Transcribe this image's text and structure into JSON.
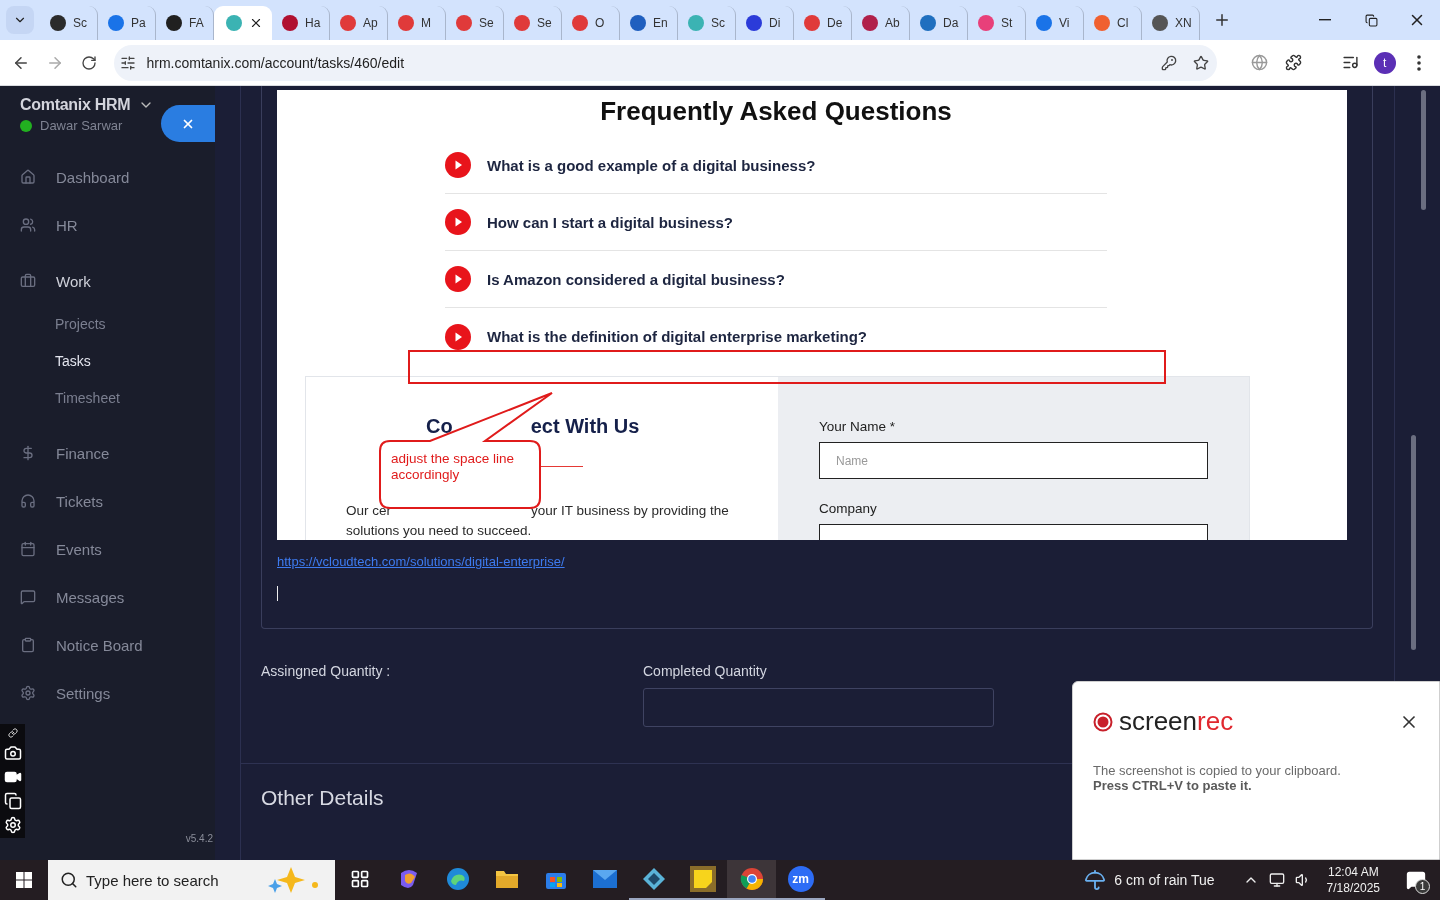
{
  "browser": {
    "tabs": [
      {
        "label": "Sc",
        "selected": false,
        "color": "#2b2b2b"
      },
      {
        "label": "Pa",
        "selected": false,
        "color": "#1a73e8"
      },
      {
        "label": "FA",
        "selected": false,
        "color": "#202020"
      },
      {
        "selected": true,
        "color": "#3bb3b3"
      },
      {
        "label": "Ha",
        "selected": false,
        "color": "#b01030"
      },
      {
        "label": "Ap",
        "selected": false,
        "color": "#e03a3a"
      },
      {
        "label": "M",
        "selected": false,
        "color": "#e03a3a"
      },
      {
        "label": "Se",
        "selected": false,
        "color": "#e03a3a"
      },
      {
        "label": "Se",
        "selected": false,
        "color": "#e03a3a"
      },
      {
        "label": "O",
        "selected": false,
        "color": "#e03a3a"
      },
      {
        "label": "En",
        "selected": false,
        "color": "#1f5fbf"
      },
      {
        "label": "Sc",
        "selected": false,
        "color": "#3bb3b3"
      },
      {
        "label": "Di",
        "selected": false,
        "color": "#2b3bd9"
      },
      {
        "label": "De",
        "selected": false,
        "color": "#e03a3a"
      },
      {
        "label": "Ab",
        "selected": false,
        "color": "#b0204a"
      },
      {
        "label": "Da",
        "selected": false,
        "color": "#1f6fbf"
      },
      {
        "label": "St",
        "selected": false,
        "color": "#e8407a"
      },
      {
        "label": "Vi",
        "selected": false,
        "color": "#1a73e8"
      },
      {
        "label": "Cl",
        "selected": false,
        "color": "#f06030"
      },
      {
        "label": "XN",
        "selected": false,
        "color": "#555555"
      }
    ],
    "url": "hrm.comtanix.com/account/tasks/460/edit",
    "profile_initial": "t"
  },
  "sidebar": {
    "title": "Comtanix HRM",
    "user": "Dawar Sarwar",
    "version": "v5.4.2",
    "items": [
      {
        "label": "Dashboard",
        "selected": false
      },
      {
        "label": "HR",
        "selected": false
      },
      {
        "label": "Work",
        "selected": true,
        "children": [
          {
            "label": "Projects",
            "selected": false
          },
          {
            "label": "Tasks",
            "selected": true
          },
          {
            "label": "Timesheet",
            "selected": false
          }
        ]
      },
      {
        "label": "Finance",
        "selected": false
      },
      {
        "label": "Tickets",
        "selected": false
      },
      {
        "label": "Events",
        "selected": false
      },
      {
        "label": "Messages",
        "selected": false
      },
      {
        "label": "Notice Board",
        "selected": false
      },
      {
        "label": "Settings",
        "selected": false
      }
    ]
  },
  "editor": {
    "embedded_page": {
      "faq_title": "Frequently Asked Questions",
      "faq": [
        "What is a good example of a digital business?",
        "How can I start a digital business?",
        "Is Amazon considered a digital business?",
        "What is the definition of digital enterprise marketing?"
      ],
      "contact_heading_parts": [
        "Co",
        "ect With Us"
      ],
      "contact_text_parts": [
        "Our cer",
        "your IT business by providing the",
        "solutions you need to succeed."
      ],
      "form_fields": [
        {
          "label": "Your Name *",
          "placeholder": "Name"
        },
        {
          "label": "Company"
        }
      ],
      "annotation": "adjust the space line accordingly"
    },
    "link": "https://vcloudtech.com/solutions/digital-enterprise/"
  },
  "quantities": {
    "assigned_label": "Assingned Quantity :",
    "completed_label": "Completed Quantity"
  },
  "section_title": "Other Details",
  "notification": {
    "logo_parts": [
      "screen",
      "rec"
    ],
    "message": "The screenshot is copied to your clipboard.",
    "hint": "Press CTRL+V to paste it."
  },
  "taskbar": {
    "search_placeholder": "Type here to search",
    "apps": [
      {
        "kind": "taskview",
        "running": false,
        "selected": false
      },
      {
        "kind": "copilot",
        "running": false,
        "selected": false
      },
      {
        "kind": "edge",
        "running": false,
        "selected": false
      },
      {
        "kind": "folder",
        "running": false,
        "selected": false
      },
      {
        "kind": "store",
        "running": false,
        "selected": false
      },
      {
        "kind": "mail",
        "running": false,
        "selected": false
      },
      {
        "kind": "diamond",
        "running": true,
        "selected": false
      },
      {
        "kind": "note",
        "running": true,
        "selected": false
      },
      {
        "kind": "chrome",
        "running": true,
        "selected": true
      },
      {
        "kind": "zoom",
        "running": true,
        "selected": false,
        "label": "zm"
      }
    ],
    "weather": "6 cm of rain Tue",
    "time": "12:04 AM",
    "date": "7/18/2025",
    "notifications": "1"
  }
}
